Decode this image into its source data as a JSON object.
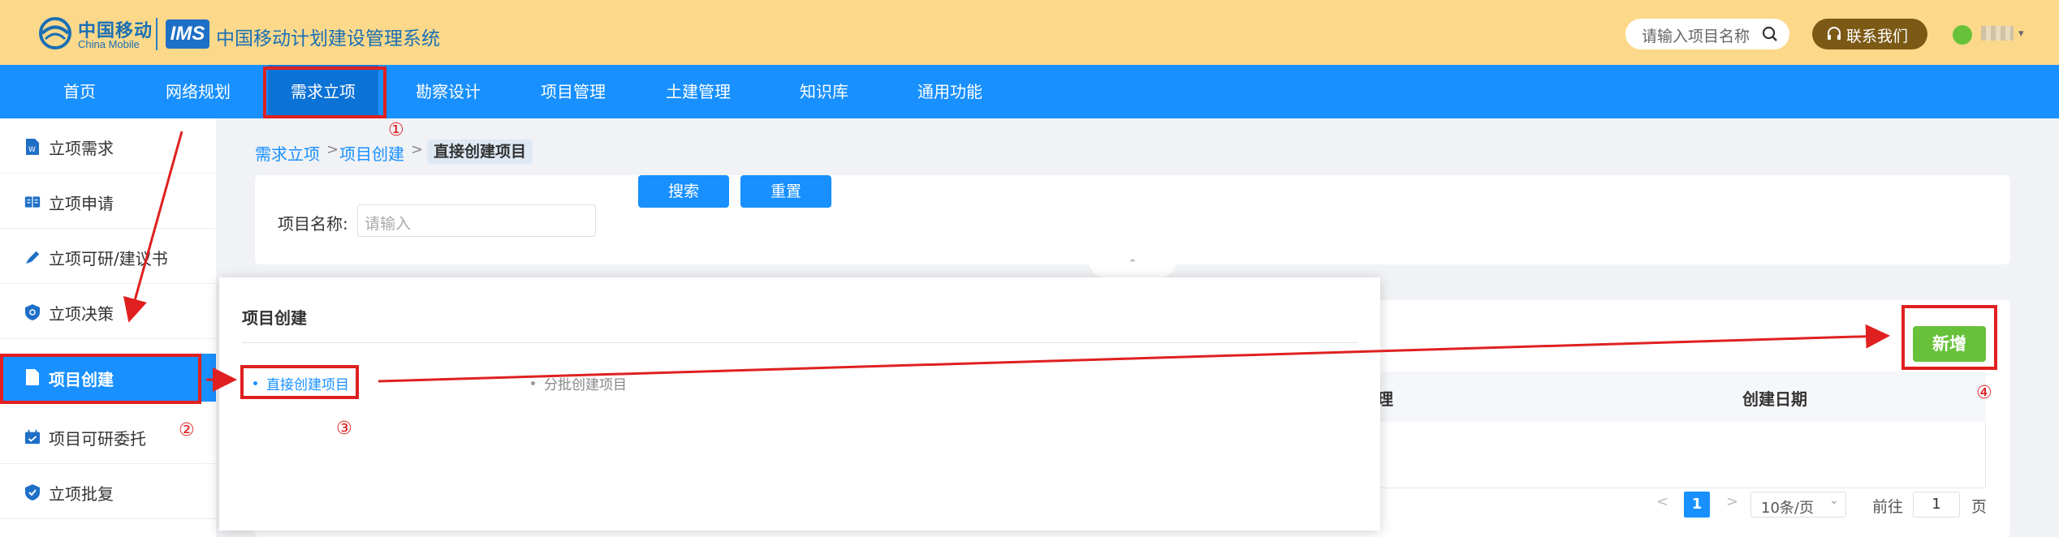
{
  "header": {
    "brand_cn": "中国移动",
    "brand_en": "China Mobile",
    "badge": "IMS",
    "system_title": "中国移动计划建设管理系统",
    "search_placeholder": "请输入项目名称",
    "contact_label": "联系我们"
  },
  "nav": {
    "items": [
      "首页",
      "网络规划",
      "需求立项",
      "勘察设计",
      "项目管理",
      "土建管理",
      "知识库",
      "通用功能"
    ],
    "active_index": 2
  },
  "sidebar": {
    "items": [
      "立项需求",
      "立项申请",
      "立项可研/建议书",
      "立项决策",
      "项目创建",
      "项目可研委托",
      "立项批复"
    ],
    "active_index": 4
  },
  "breadcrumb": [
    "需求立项",
    "项目创建",
    "直接创建项目"
  ],
  "search_form": {
    "label": "项目名称:",
    "placeholder": "请输入",
    "search_button": "搜索",
    "reset_button": "重置"
  },
  "popup": {
    "title": "项目创建",
    "options": [
      "直接创建项目",
      "分批创建项目"
    ]
  },
  "table": {
    "add_button": "新增",
    "column_partial": "理",
    "column_date": "创建日期"
  },
  "pagination": {
    "prev": "<",
    "current": "1",
    "next": ">",
    "page_size": "10条/页",
    "goto_label": "前往",
    "goto_value": "1",
    "page_suffix": "页"
  },
  "annotations": [
    "①",
    "②",
    "③",
    "④"
  ],
  "colors": {
    "header_bg": "#fcd98a",
    "nav_bg": "#1890ff",
    "accent_blue": "#1890ff",
    "add_green": "#67c23a",
    "annotation_red": "#e02020"
  }
}
